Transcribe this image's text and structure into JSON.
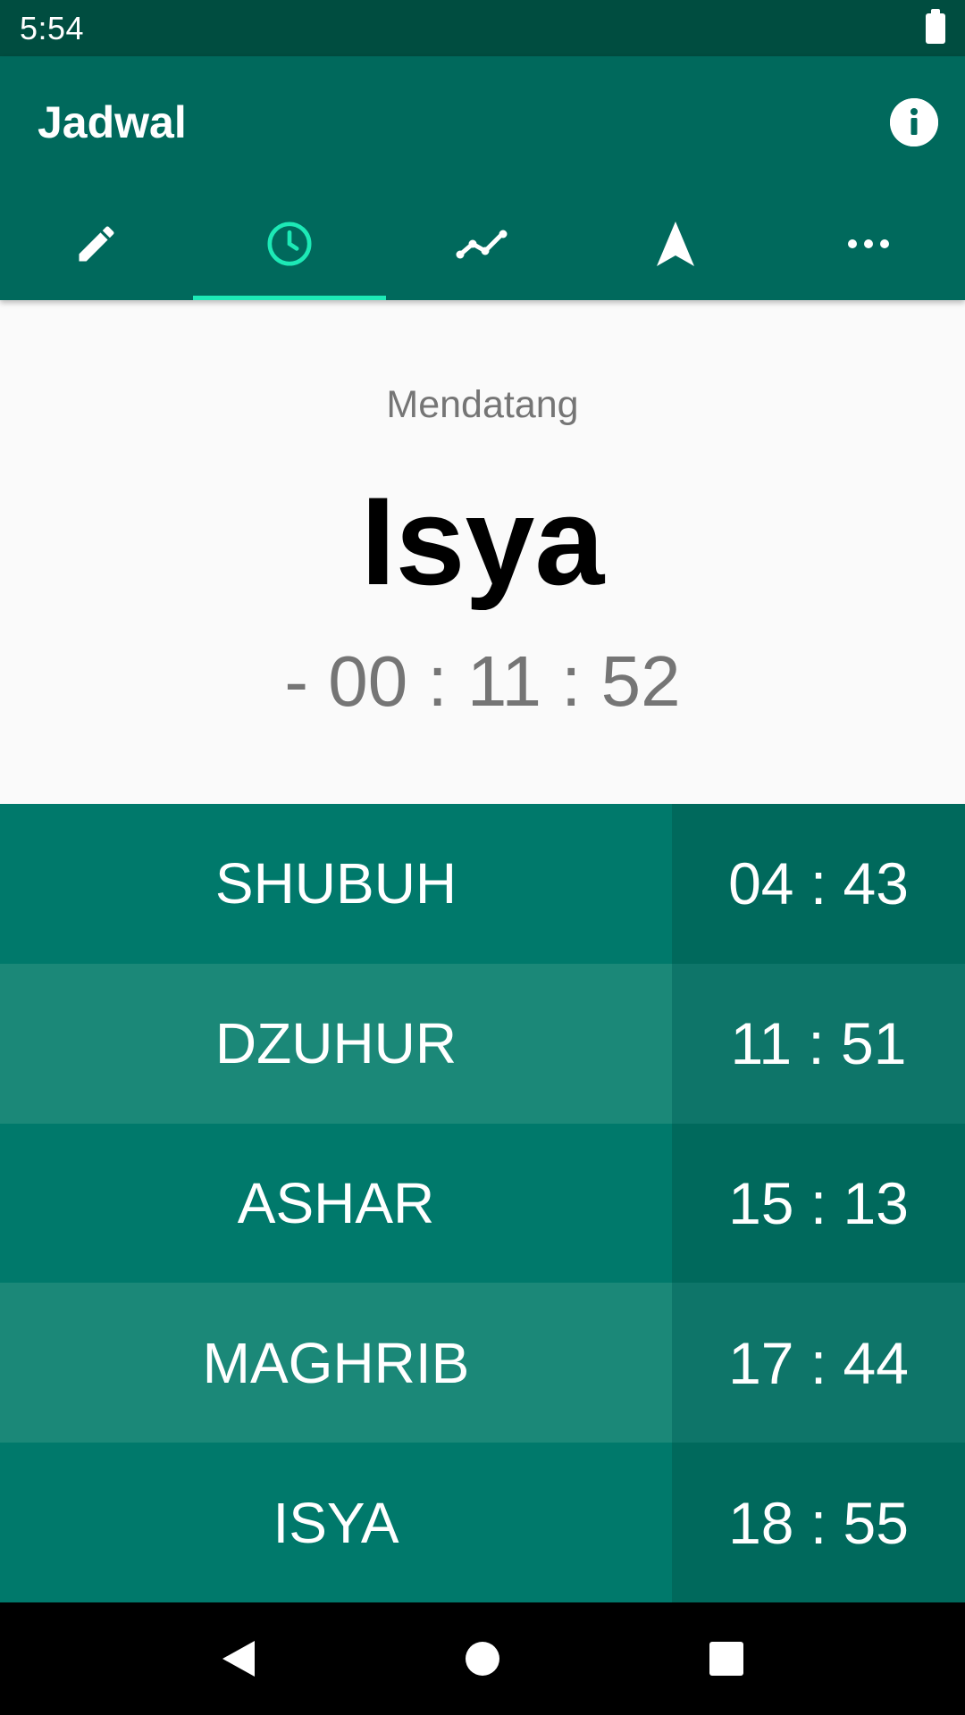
{
  "status_bar": {
    "time": "5:54",
    "battery_icon": "battery-full-icon"
  },
  "app_bar": {
    "title": "Jadwal",
    "info_icon": "info-icon",
    "background": "#00695c",
    "accent": "#1de9b6"
  },
  "tabs": [
    {
      "icon": "edit-icon",
      "active": false
    },
    {
      "icon": "clock-icon",
      "active": true
    },
    {
      "icon": "chart-line-icon",
      "active": false
    },
    {
      "icon": "navigation-arrow-icon",
      "active": false
    },
    {
      "icon": "more-horizontal-icon",
      "active": false
    }
  ],
  "upcoming": {
    "label": "Mendatang",
    "name": "Isya",
    "countdown": "- 00 : 11 : 52"
  },
  "prayer_times": [
    {
      "name": "SHUBUH",
      "time": "04 : 43"
    },
    {
      "name": "DZUHUR",
      "time": "11 : 51"
    },
    {
      "name": "ASHAR",
      "time": "15 : 13"
    },
    {
      "name": "MAGHRIB",
      "time": "17 : 44"
    },
    {
      "name": "ISYA",
      "time": "18 : 55"
    }
  ],
  "nav_bar": {
    "back_icon": "back-icon",
    "home_icon": "home-icon",
    "recents_icon": "recents-icon"
  }
}
